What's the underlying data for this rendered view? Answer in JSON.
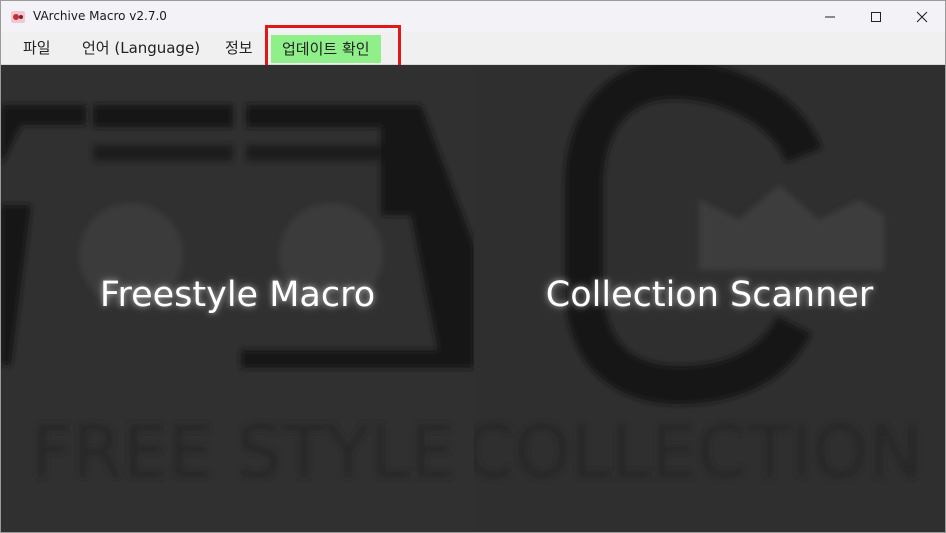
{
  "window": {
    "title": "VArchive Macro v2.7.0",
    "icon": "app-icon"
  },
  "menu": {
    "file": "파일",
    "language": "언어 (Language)",
    "info": "정보",
    "update": "업데이트 확인",
    "update_bg": "#8ff08a",
    "highlight_color": "#e01818"
  },
  "panels": {
    "left": {
      "label": "Freestyle Macro",
      "bg_text": "FREE STYLE"
    },
    "right": {
      "label": "Collection Scanner",
      "bg_text": "COLLECTION"
    }
  }
}
